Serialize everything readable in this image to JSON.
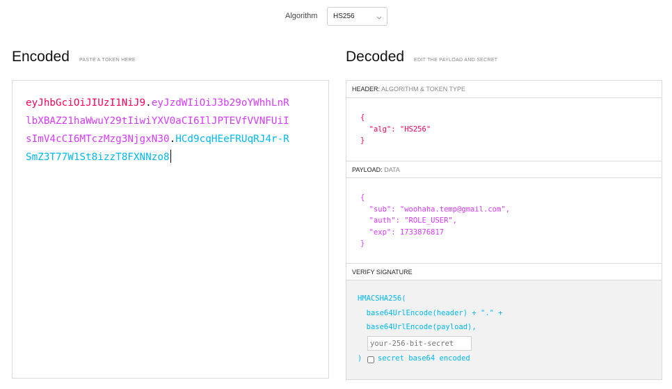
{
  "algorithm": {
    "label": "Algorithm",
    "selected": "HS256"
  },
  "encoded": {
    "title": "Encoded",
    "subtitle": "PASTE A TOKEN HERE",
    "token_header": "eyJhbGciOiJIUzI1NiJ9",
    "token_payload": "eyJzdWIiOiJ3b29oYWhhLnRlbXBAZ21haWwuY29tIiwiYXV0aCI6IlJPTEVfVVNFUiIsImV4cCI6MTczMzg3NjgxN30",
    "token_signature": "HCd9cqHEeFRUqRJ4r-RSmZ3T77W1St8izzT8FXNNzo8",
    "dot": "."
  },
  "decoded": {
    "title": "Decoded",
    "subtitle": "EDIT THE PAYLOAD AND SECRET",
    "header_section": {
      "label": "HEADER:",
      "sublabel": "ALGORITHM & TOKEN TYPE"
    },
    "header_json": "{\n  \"alg\": \"HS256\"\n}",
    "payload_section": {
      "label": "PAYLOAD:",
      "sublabel": "DATA"
    },
    "payload_json": "{\n  \"sub\": \"woohaha.temp@gmail.com\",\n  \"auth\": \"ROLE_USER\",\n  \"exp\": 1733876817\n}",
    "verify_section": {
      "label": "VERIFY SIGNATURE"
    },
    "verify": {
      "line1": "HMACSHA256(",
      "line2": "  base64UrlEncode(header) + \".\" +",
      "line3": "  base64UrlEncode(payload),",
      "secret_placeholder": "your-256-bit-secret",
      "close": ")",
      "checkbox_label": "secret base64 encoded"
    }
  },
  "colors": {
    "header": "#fb015b",
    "payload": "#d63aff",
    "signature": "#00b9f1"
  }
}
